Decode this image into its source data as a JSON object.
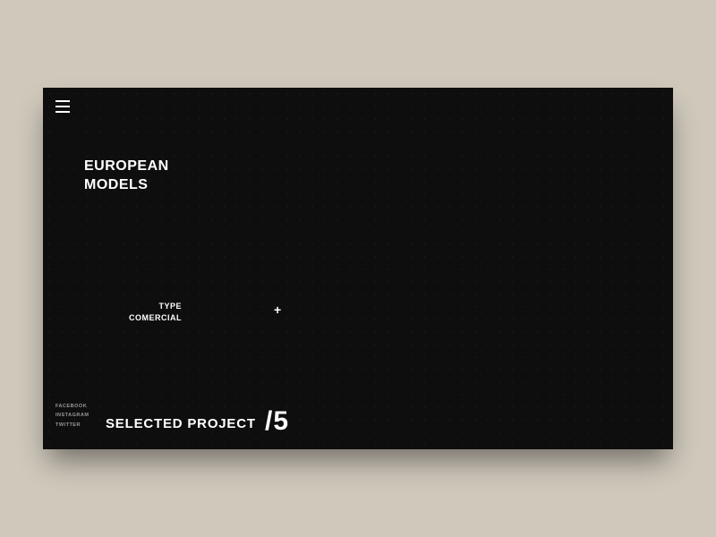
{
  "title": {
    "line1": "EUROPEAN",
    "line2": "MODELS"
  },
  "meta": {
    "label": "TYPE",
    "value": "COMERCIAL"
  },
  "plus": "+",
  "socials": {
    "items": [
      "FACEBOOK",
      "INSTAGRAM",
      "TWITTER"
    ]
  },
  "footer": {
    "selected_label": "SELECTED PROJECT",
    "counter": "/5"
  }
}
